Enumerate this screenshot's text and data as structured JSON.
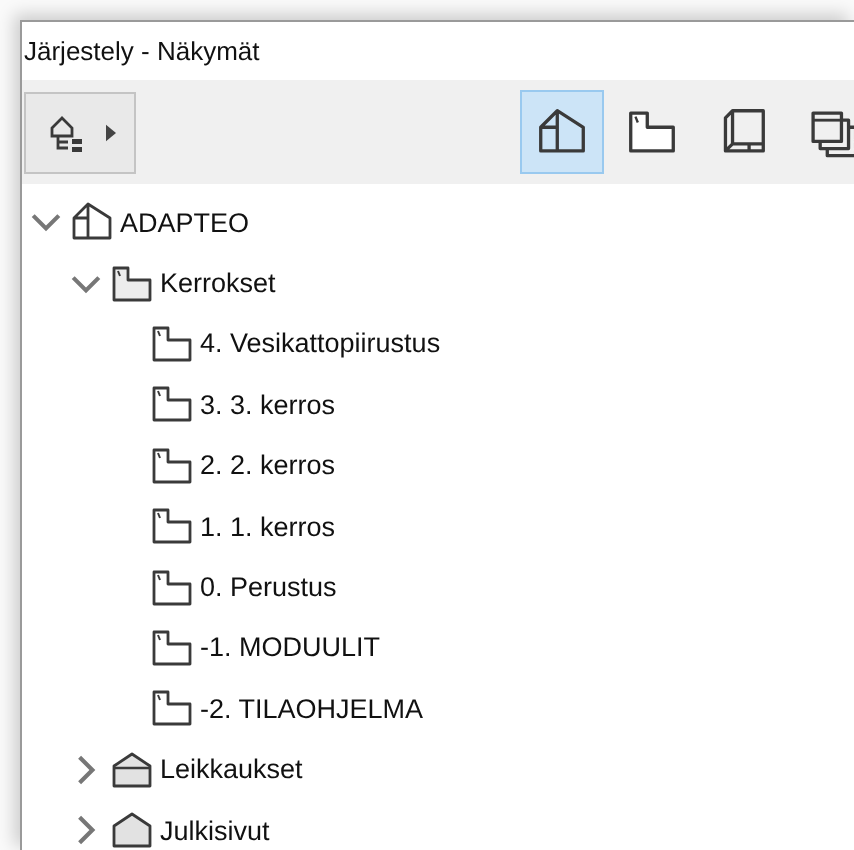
{
  "window": {
    "title": "Järjestely - Näkymät"
  },
  "toolbar": {
    "menu_button": {
      "kind": "view-map-options"
    },
    "map_buttons": [
      {
        "kind": "project",
        "selected": true
      },
      {
        "kind": "story",
        "selected": false
      },
      {
        "kind": "layout",
        "selected": false
      },
      {
        "kind": "publisher",
        "selected": false
      }
    ]
  },
  "tree": [
    {
      "kind": "project",
      "label": "ADAPTEO",
      "expanded": true,
      "children": [
        {
          "kind": "story-folder",
          "label": "Kerrokset",
          "expanded": true,
          "children": [
            {
              "kind": "story",
              "label": "4. Vesikattopiirustus"
            },
            {
              "kind": "story",
              "label": "3. 3. kerros"
            },
            {
              "kind": "story",
              "label": "2. 2. kerros"
            },
            {
              "kind": "story",
              "label": "1. 1. kerros"
            },
            {
              "kind": "story",
              "label": "0. Perustus"
            },
            {
              "kind": "story",
              "label": "-1. MODUULIT"
            },
            {
              "kind": "story",
              "label": "-2. TILAOHJELMA"
            }
          ]
        },
        {
          "kind": "section",
          "label": "Leikkaukset",
          "expanded": false
        },
        {
          "kind": "elevation",
          "label": "Julkisivut",
          "expanded": false
        }
      ]
    }
  ]
}
